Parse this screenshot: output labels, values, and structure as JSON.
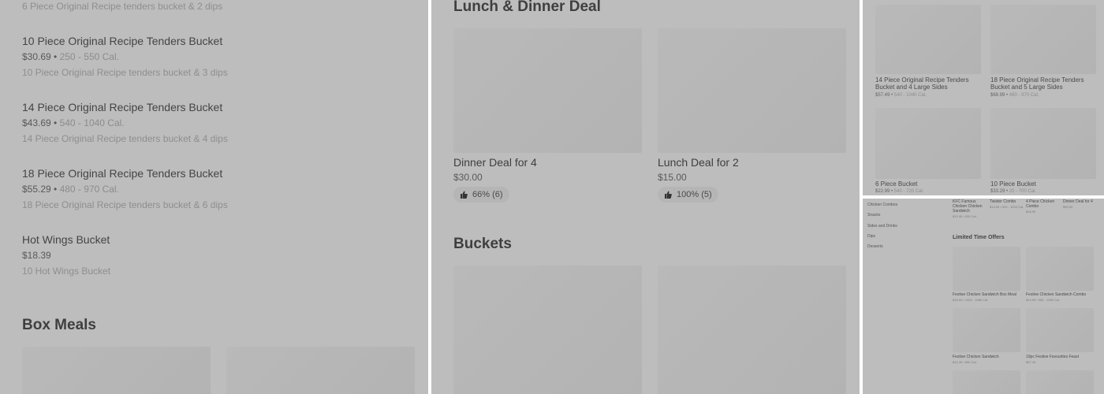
{
  "panel_a": {
    "top_desc": "6 Piece Original Recipe tenders bucket & 2 dips",
    "items": [
      {
        "name": "10 Piece Original Recipe Tenders Bucket",
        "price": "$30.69",
        "cal": "250 - 550 Cal.",
        "desc": "10 Piece Original Recipe tenders bucket & 3 dips"
      },
      {
        "name": "14 Piece Original Recipe Tenders Bucket",
        "price": "$43.69",
        "cal": "540 - 1040 Cal.",
        "desc": "14 Piece Original Recipe tenders bucket & 4 dips"
      },
      {
        "name": "18 Piece Original Recipe Tenders Bucket",
        "price": "$55.29",
        "cal": "480 - 970 Cal.",
        "desc": "18 Piece Original Recipe tenders bucket & 6 dips"
      },
      {
        "name": "Hot Wings Bucket",
        "price": "$18.39",
        "cal": "",
        "desc": "10 Hot Wings Bucket"
      }
    ],
    "section_title": "Box Meals",
    "sep": " • "
  },
  "panel_b": {
    "section1": "Lunch & Dinner Deal",
    "cards": [
      {
        "name": "Dinner Deal for 4",
        "price": "$30.00",
        "rating": "66% (6)"
      },
      {
        "name": "Lunch Deal for 2",
        "price": "$15.00",
        "rating": "100% (5)"
      }
    ],
    "section2": "Buckets"
  },
  "panel_c": {
    "items": [
      {
        "name": "14 Piece Original Recipe Tenders Bucket and 4 Large Sides",
        "price": "$57.49",
        "cal": "540 - 1040 Cal."
      },
      {
        "name": "18 Piece Original Recipe Tenders Bucket and 5 Large Sides",
        "price": "$68.99",
        "cal": "480 - 970 Cal."
      },
      {
        "name": "6 Piece Bucket",
        "price": "$22.99",
        "cal": "540 - 720 Cal."
      },
      {
        "name": "10 Piece Bucket",
        "price": "$33.29",
        "cal": "20 - 700 Cal."
      }
    ]
  },
  "panel_d": {
    "sidebar": [
      "Chicken Combos",
      "Snacks",
      "Sides and Drinks",
      "Dips",
      "Desserts"
    ],
    "top_items": [
      {
        "name": "KFC Famous Chicken Chicken Sandwich",
        "meta": "$12.49 • 520 Cal."
      },
      {
        "name": "Twister Combo",
        "meta": "$14.99 • 520 - 1000 Cal."
      },
      {
        "name": "4 Piece Chicken Combo",
        "meta": "$18.99"
      },
      {
        "name": "Dinner Deal for 4",
        "meta": "$30.00"
      }
    ],
    "section": "Limited Time Offers",
    "offers": [
      {
        "name": "Festive Chicken Sandwich Box Meal",
        "meta": "$18.99 • 1000 - 1680 Cal."
      },
      {
        "name": "Festive Chicken Sandwich Combo",
        "meta": "$14.99 • 960 - 1280 Cal."
      },
      {
        "name": "Festive Chicken Sandwich",
        "meta": "$12.49 • 650 Cal."
      },
      {
        "name": "10pc Festive Favourites Feast",
        "meta": "$57.49"
      }
    ]
  }
}
